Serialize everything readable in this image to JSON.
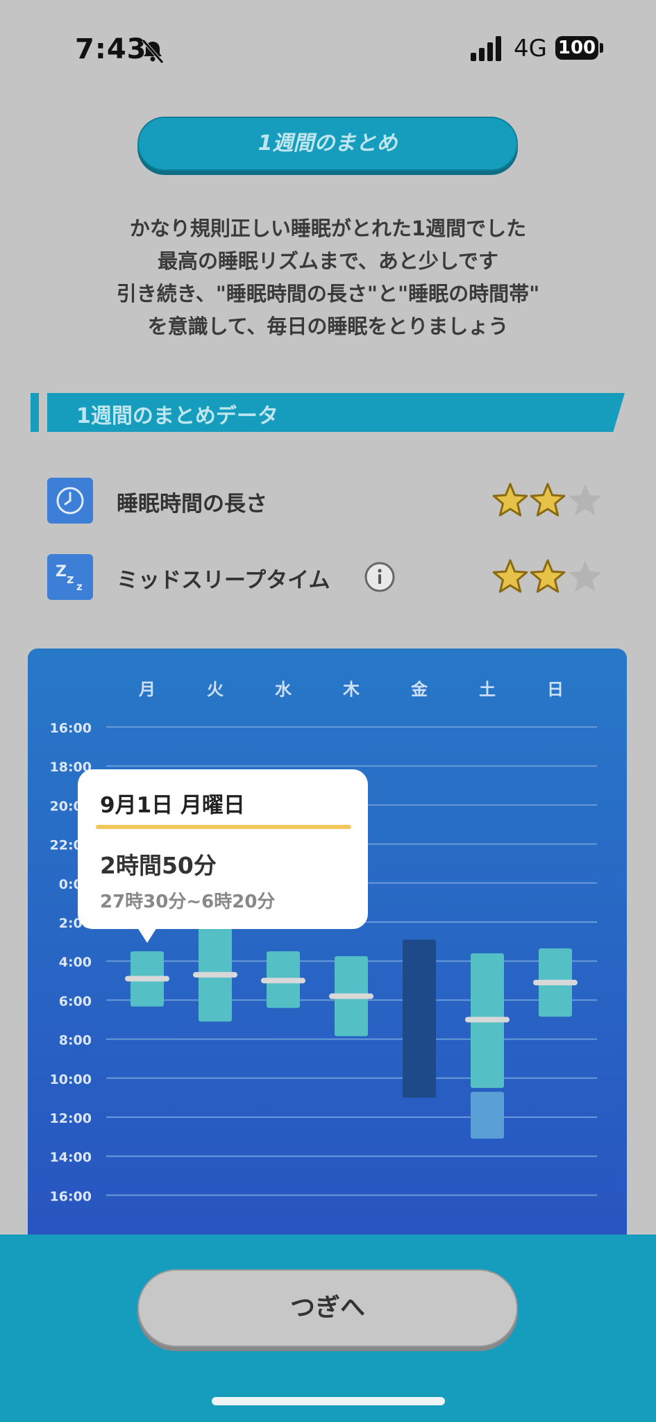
{
  "status_bar": {
    "time": "7:43",
    "network": "4G",
    "battery": "100",
    "icons": [
      "bell-slash-icon",
      "signal-icon",
      "battery-icon"
    ]
  },
  "title": "1週間のまとめ",
  "message_lines": [
    "かなり規則正しい睡眠がとれた1週間でした",
    "最高の睡眠リズムまで、あと少しです",
    "引き続き、\"睡眠時間の長さ\"と\"睡眠の時間帯\"",
    "を意識して、毎日の睡眠をとりましょう"
  ],
  "section_title": "1週間のまとめデータ",
  "metrics": [
    {
      "label": "睡眠時間の長さ",
      "icon": "clock-icon",
      "stars": 2,
      "max_stars": 3
    },
    {
      "label": "ミッドスリープタイム",
      "icon": "zzz-icon",
      "stars": 2,
      "max_stars": 3,
      "info_icon": "info-icon"
    }
  ],
  "tooltip": {
    "date": "9月1日 月曜日",
    "duration": "2時間50分",
    "range": "27時30分~6時20分"
  },
  "chart_data": {
    "type": "range-bar",
    "days": [
      "月",
      "火",
      "水",
      "木",
      "金",
      "土",
      "日"
    ],
    "y_ticks": [
      "16:00",
      "18:00",
      "20:00",
      "22:00",
      "0:00",
      "2:00",
      "4:00",
      "6:00",
      "8:00",
      "10:00",
      "12:00",
      "14:00",
      "16:00"
    ],
    "y_range_hours": [
      16,
      40
    ],
    "sleep": [
      {
        "day": "月",
        "start": 27.5,
        "end": 30.33,
        "mid": 28.9
      },
      {
        "day": "火",
        "start": 26.3,
        "end": 31.1,
        "mid": 28.7
      },
      {
        "day": "水",
        "start": 27.5,
        "end": 30.4,
        "mid": 29.0
      },
      {
        "day": "木",
        "start": 27.75,
        "end": 31.85,
        "mid": 29.8
      },
      {
        "day": "金",
        "start": 26.9,
        "end": 35.0,
        "highlight": "dark"
      },
      {
        "day": "土",
        "start": 27.6,
        "end": 34.5,
        "mid": 31.0,
        "extra": {
          "start": 34.7,
          "end": 37.1
        }
      },
      {
        "day": "日",
        "start": 27.35,
        "end": 30.85,
        "mid": 29.1
      }
    ],
    "colors": {
      "bar": "#55bfc6",
      "bar_dark": "#1e4a8a",
      "bar_extra": "#5aa0d6",
      "mid_marker": "#d8d8d8",
      "grid": "#6a9ad8"
    }
  },
  "next_button": "つぎへ"
}
